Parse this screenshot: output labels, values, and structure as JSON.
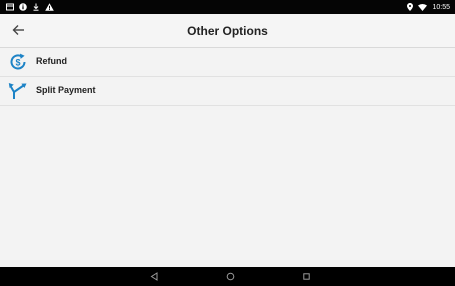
{
  "status_bar": {
    "time": "10:55",
    "left_icons": [
      "screen-icon",
      "info-icon",
      "download-icon",
      "warning-icon"
    ],
    "right_icons": [
      "location-icon",
      "wifi-icon"
    ]
  },
  "app_bar": {
    "back_icon": "back-arrow-icon",
    "title": "Other Options"
  },
  "options": [
    {
      "label": "Refund",
      "icon": "refund-icon"
    },
    {
      "label": "Split Payment",
      "icon": "split-arrows-icon"
    }
  ],
  "nav_bar": {
    "buttons": [
      "back-triangle-icon",
      "home-circle-icon",
      "recents-square-icon"
    ]
  },
  "colors": {
    "accent": "#1d83c6",
    "status_bar": "#050505",
    "nav_bar": "#000000",
    "background": "#f3f3f3"
  }
}
